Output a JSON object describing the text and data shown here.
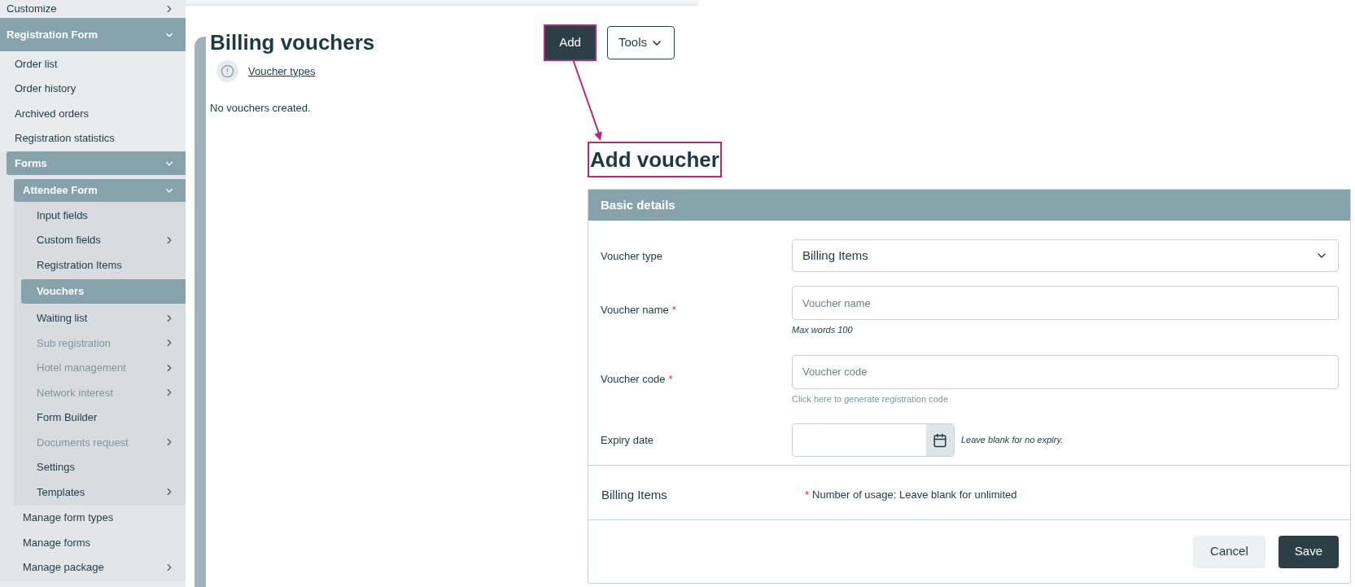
{
  "sidebar": {
    "items": [
      {
        "label": "Customize",
        "expanded": false,
        "selected": false
      },
      {
        "label": "Registration Form",
        "expanded": true,
        "selected": false,
        "children": [
          {
            "label": "Order list",
            "selected": false
          },
          {
            "label": "Order history",
            "selected": false
          },
          {
            "label": "Archived orders",
            "selected": false
          },
          {
            "label": "Registration statistics",
            "selected": false
          },
          {
            "label": "Forms",
            "expanded": true,
            "selected": false,
            "children": [
              {
                "label": "Attendee Form",
                "expanded": true,
                "selected": false,
                "children": [
                  {
                    "label": "Input fields",
                    "selected": false,
                    "disabled": false
                  },
                  {
                    "label": "Custom fields",
                    "expanded": false,
                    "selected": false,
                    "disabled": false
                  },
                  {
                    "label": "Registration Items",
                    "selected": false,
                    "disabled": false
                  },
                  {
                    "label": "Vouchers",
                    "selected": true,
                    "disabled": false
                  },
                  {
                    "label": "Waiting list",
                    "expanded": false,
                    "selected": false,
                    "disabled": false
                  },
                  {
                    "label": "Sub registration",
                    "expanded": false,
                    "selected": false,
                    "disabled": true
                  },
                  {
                    "label": "Hotel management",
                    "expanded": false,
                    "selected": false,
                    "disabled": true
                  },
                  {
                    "label": "Network interest",
                    "expanded": false,
                    "selected": false,
                    "disabled": true
                  },
                  {
                    "label": "Form Builder",
                    "selected": false,
                    "disabled": false
                  },
                  {
                    "label": "Documents request",
                    "expanded": false,
                    "selected": false,
                    "disabled": true
                  },
                  {
                    "label": "Settings",
                    "selected": false,
                    "disabled": false
                  },
                  {
                    "label": "Templates",
                    "expanded": false,
                    "selected": false,
                    "disabled": false
                  }
                ]
              },
              {
                "label": "Manage form types",
                "selected": false
              },
              {
                "label": "Manage forms",
                "selected": false
              },
              {
                "label": "Manage package",
                "expanded": false,
                "selected": false
              }
            ]
          }
        ]
      }
    ]
  },
  "page": {
    "title": "Billing vouchers",
    "info_link": "Voucher types",
    "empty_message": "No vouchers created.",
    "buttons": [
      {
        "label": "Add",
        "kind": "primary",
        "highlighted": true
      },
      {
        "label": "Tools",
        "kind": "dropdown",
        "highlighted": false
      }
    ]
  },
  "add_voucher": {
    "title": "Add voucher",
    "highlighted": true,
    "section_title": "Basic details",
    "required_mark": "*",
    "fields": [
      {
        "kind": "select",
        "label": "Voucher type",
        "value": "Billing Items",
        "required": false
      },
      {
        "kind": "text",
        "label": "Voucher name",
        "placeholder": "Voucher name",
        "required": true,
        "hint": "Max words 100"
      },
      {
        "kind": "text",
        "label": "Voucher code",
        "placeholder": "Voucher code",
        "required": true,
        "link": "Click here to generate registration code"
      },
      {
        "kind": "date",
        "label": "Expiry date",
        "required": false,
        "note": "Leave blank for no expiry."
      }
    ],
    "billing": {
      "title": "Billing Items",
      "note": "Number of usage: Leave blank for unlimited",
      "required": true
    },
    "buttons": [
      {
        "label": "Cancel",
        "kind": "secondary"
      },
      {
        "label": "Save",
        "kind": "primary"
      }
    ]
  }
}
